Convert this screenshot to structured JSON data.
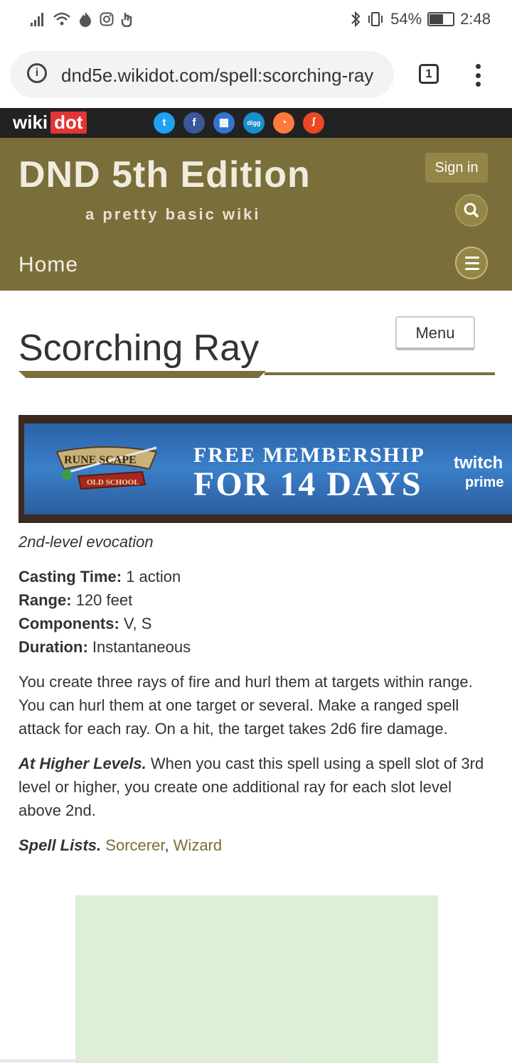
{
  "status_bar": {
    "battery": "54%",
    "time": "2:48",
    "icons": [
      "signal-icon",
      "wifi-icon",
      "flame-icon",
      "instagram-icon",
      "hand-icon",
      "bluetooth-icon",
      "vibrate-icon",
      "battery-icon"
    ]
  },
  "browser": {
    "url": "dnd5e.wikidot.com/spell:scorching-ray",
    "tab_count": "1"
  },
  "wikidot_bar": {
    "logo_part1": "wiki",
    "logo_part2": "dot",
    "social_icons": [
      {
        "name": "twitter-icon",
        "color": "#1da1f2",
        "glyph": "t"
      },
      {
        "name": "facebook-icon",
        "color": "#3b5998",
        "glyph": "f"
      },
      {
        "name": "delicious-icon",
        "color": "#3274d2",
        "glyph": "▦"
      },
      {
        "name": "digg-icon",
        "color": "#1a8fd0",
        "glyph": "digg"
      },
      {
        "name": "reddit-icon",
        "color": "#ff7a3c",
        "glyph": "◔"
      },
      {
        "name": "stumbleupon-icon",
        "color": "#eb4924",
        "glyph": "ꭍ"
      }
    ]
  },
  "site": {
    "title": "DND 5th Edition",
    "subtitle": "a pretty basic wiki",
    "sign_in": "Sign in",
    "home": "Home",
    "accent_color": "#7a6e3b"
  },
  "page": {
    "menu_label": "Menu",
    "title": "Scorching Ray"
  },
  "ad_banner": {
    "logo_text": "RUNE SCAPE",
    "logo_sub": "OLD SCHOOL",
    "line1": "FREE MEMBERSHIP",
    "line2": "FOR 14 DAYS",
    "brand": "twitch",
    "brand_sub": "prime"
  },
  "spell": {
    "school": "2nd-level evocation",
    "casting_time_label": "Casting Time:",
    "casting_time": "1 action",
    "range_label": "Range:",
    "range": "120 feet",
    "components_label": "Components:",
    "components": "V, S",
    "duration_label": "Duration:",
    "duration": "Instantaneous",
    "description": "You create three rays of fire and hurl them at targets within range. You can hurl them at one target or several. Make a ranged spell attack for each ray. On a hit, the target takes 2d6 fire damage.",
    "higher_levels_label": "At Higher Levels.",
    "higher_levels": "When you cast this spell using a spell slot of 3rd level or higher, you create one additional ray for each slot level above 2nd.",
    "spell_lists_label": "Spell Lists.",
    "spell_lists": [
      "Sorcerer",
      "Wizard"
    ],
    "list_separator": ", "
  }
}
